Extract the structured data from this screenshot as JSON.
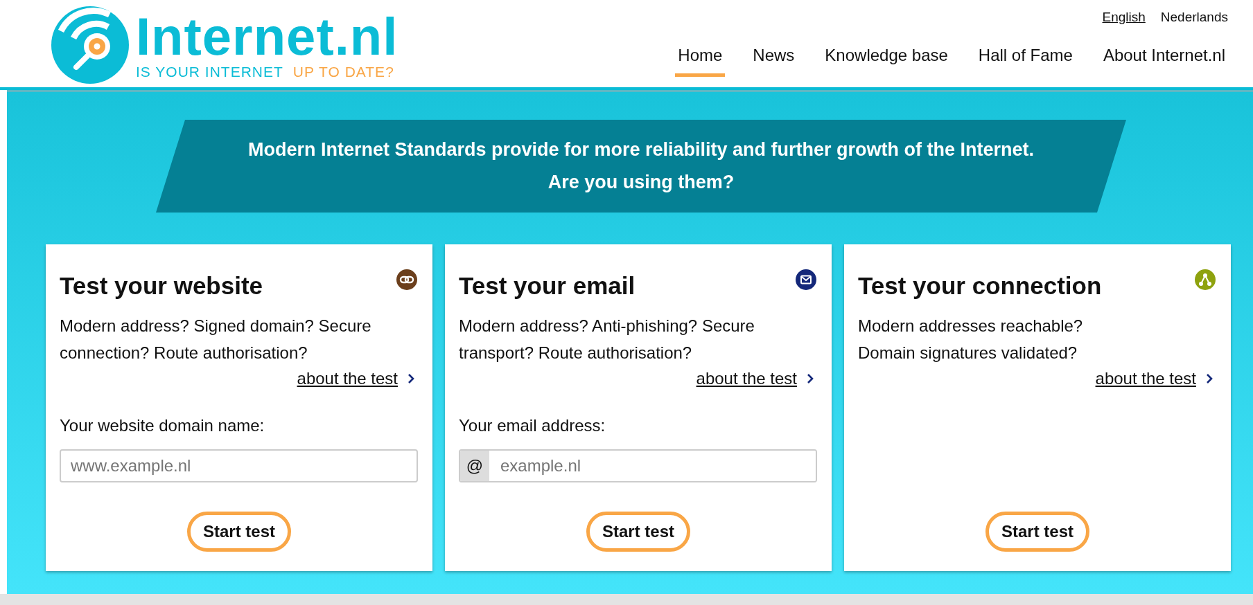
{
  "logo": {
    "name": "Internet.nl",
    "tagline_start": "IS YOUR INTERNET",
    "tagline_end": "UP TO DATE?"
  },
  "languages": [
    {
      "label": "English",
      "selected": true
    },
    {
      "label": "Nederlands",
      "selected": false
    }
  ],
  "nav": [
    {
      "label": "Home",
      "selected": true
    },
    {
      "label": "News",
      "selected": false
    },
    {
      "label": "Knowledge base",
      "selected": false
    },
    {
      "label": "Hall of Fame",
      "selected": false
    },
    {
      "label": "About Internet.nl",
      "selected": false
    }
  ],
  "banner": {
    "line_1": "Modern Internet Standards provide for more reliability and further growth of the Internet.",
    "line_2": "Are you using them?"
  },
  "cards": [
    {
      "kind": "website",
      "title": "Test your website",
      "color": "#6b3f1c",
      "description": "Modern address? Signed domain? Secure connection? Route authorisation?",
      "link": "about the test",
      "field_label": "Your website domain name:",
      "placeholder": "www.example.nl",
      "button": "Start test"
    },
    {
      "kind": "email",
      "title": "Test your email",
      "color": "#14287a",
      "description": "Modern address? Anti-phishing? Secure transport? Route authorisation?",
      "link": "about the test",
      "field_label": "Your email address:",
      "prefix": "@",
      "placeholder": "example.nl",
      "button": "Start test"
    },
    {
      "kind": "connection",
      "title": "Test your connection",
      "color": "#8ea20e",
      "description": "Modern addresses reachable?\nDomain signatures validated?",
      "link": "about the test",
      "button": "Start test"
    }
  ]
}
